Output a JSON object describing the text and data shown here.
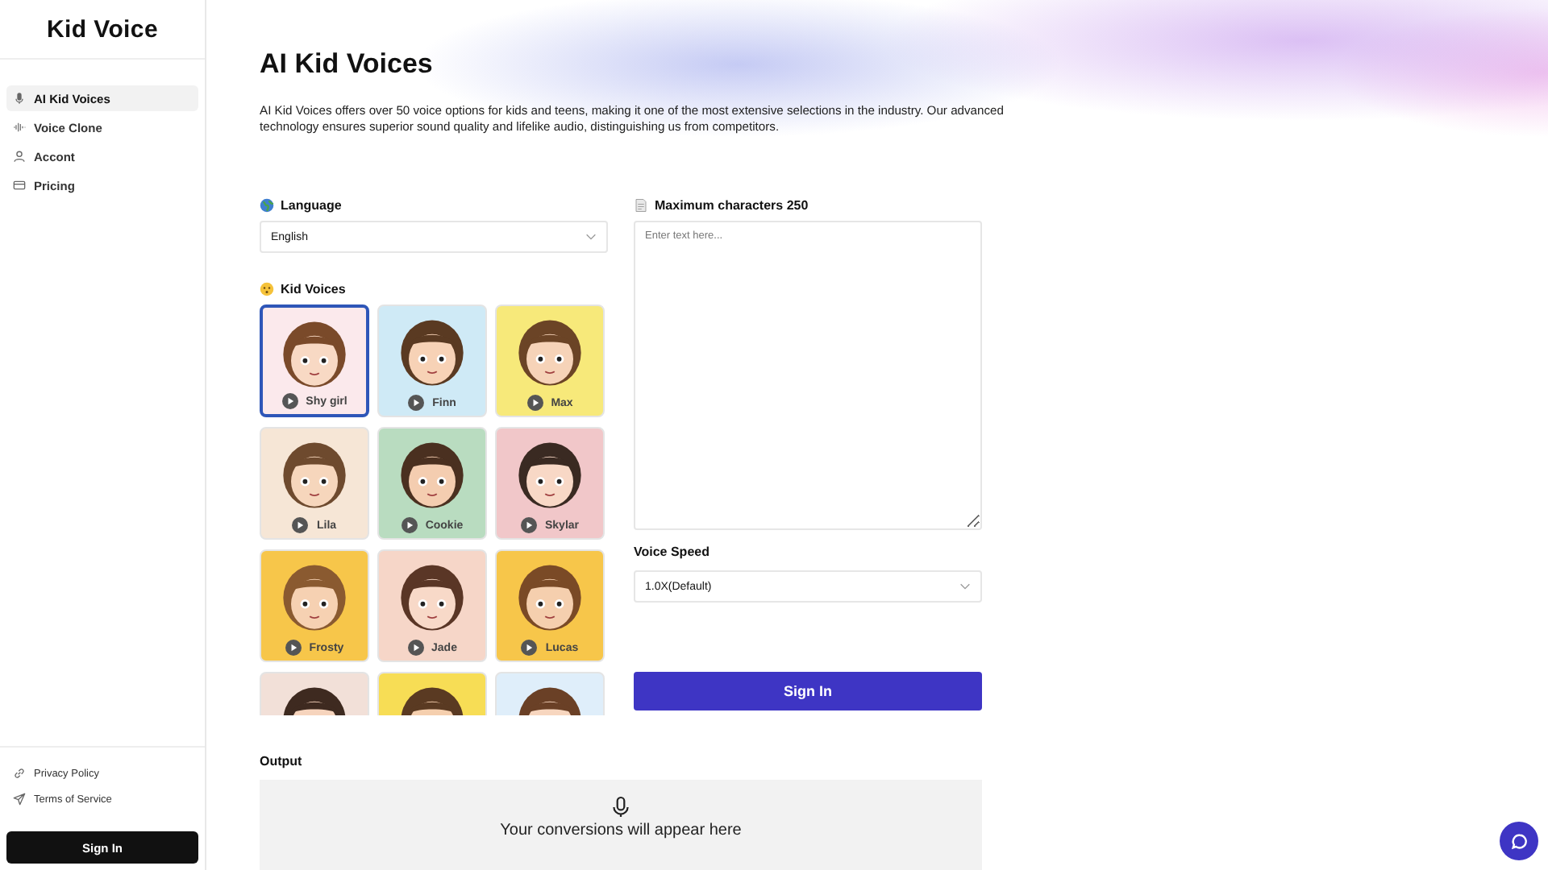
{
  "sidebar": {
    "logo": "Kid Voice",
    "items": [
      {
        "label": "AI Kid Voices",
        "kind": "mic",
        "selected": true
      },
      {
        "label": "Voice Clone",
        "kind": "wave",
        "selected": false
      },
      {
        "label": "Accont",
        "kind": "user",
        "selected": false
      },
      {
        "label": "Pricing",
        "kind": "card",
        "selected": false
      }
    ],
    "footer_links": [
      {
        "label": "Privacy Policy",
        "kind": "link"
      },
      {
        "label": "Terms of Service",
        "kind": "send"
      }
    ],
    "sign_in": "Sign In"
  },
  "page": {
    "title": "AI Kid Voices",
    "description": "AI Kid Voices offers over 50 voice options for kids and teens, making it one of the most extensive selections in the industry. Our advanced technology ensures superior sound quality and lifelike audio, distinguishing us from competitors."
  },
  "language": {
    "label": "Language",
    "value": "English"
  },
  "voices_label": "Kid Voices",
  "voices": [
    {
      "name": "Shy girl",
      "selected": true
    },
    {
      "name": "Finn",
      "selected": false
    },
    {
      "name": "Max",
      "selected": false
    },
    {
      "name": "Lila",
      "selected": false
    },
    {
      "name": "Cookie",
      "selected": false
    },
    {
      "name": "Skylar",
      "selected": false
    },
    {
      "name": "Frosty",
      "selected": false
    },
    {
      "name": "Jade",
      "selected": false
    },
    {
      "name": "Lucas",
      "selected": false
    },
    {
      "selected": false
    },
    {
      "selected": false
    },
    {
      "selected": false
    }
  ],
  "text_input": {
    "label": "Maximum characters 250",
    "placeholder": "Enter text here..."
  },
  "speed": {
    "label": "Voice Speed",
    "value": "1.0X(Default)"
  },
  "submit": "Sign In",
  "output": {
    "label": "Output",
    "message": "Your conversions will appear here"
  }
}
